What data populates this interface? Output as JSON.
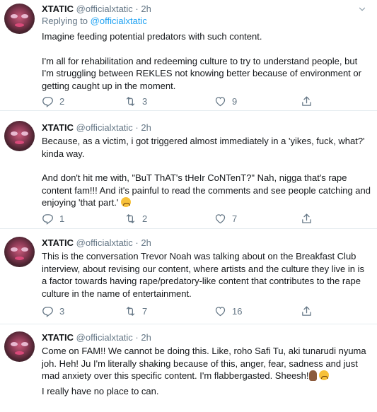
{
  "tweets": [
    {
      "name": "XTATIC",
      "handle": "@officialxtatic",
      "dot": "·",
      "time": "2h",
      "reply_prefix": "Replying to",
      "reply_to": "@officialxtatic",
      "paragraphs": [
        "Imagine feeding potential predators with such content.",
        "I'm all for rehabilitation and redeeming culture to try to understand people, but I'm struggling between REKLES not knowing better because of environment or getting caught up in the moment."
      ],
      "replies": "2",
      "retweets": "3",
      "likes": "9"
    },
    {
      "name": "XTATIC",
      "handle": "@officialxtatic",
      "dot": "·",
      "time": "2h",
      "paragraphs": [
        "Because, as a victim, i got triggered almost immediately in a 'yikes, fuck, what?' kinda way.",
        "And don't hit me with, \"BuT ThAT's tHeIr CoNTenT?\" Nah, nigga that's rape content fam!!! And it's painful to read the comments and see people catching and enjoying 'that part.'"
      ],
      "replies": "1",
      "retweets": "2",
      "likes": "7"
    },
    {
      "name": "XTATIC",
      "handle": "@officialxtatic",
      "dot": "·",
      "time": "2h",
      "paragraphs": [
        "This is the conversation Trevor Noah was talking about on the Breakfast Club interview, about revising our content, where artists and the culture they live in is a factor towards having rape/predatory-like content that contributes to the rape culture in the name of entertainment."
      ],
      "replies": "3",
      "retweets": "7",
      "likes": "16"
    },
    {
      "name": "XTATIC",
      "handle": "@officialxtatic",
      "dot": "·",
      "time": "2h",
      "paragraphs": [
        "Come on FAM!! We cannot be doing this. Like, roho Safi Tu, aki tunarudi nyuma joh. Heh! Ju I'm literally shaking because of this, anger, fear, sadness and just mad anxiety over this specific content. I'm flabbergasted. Sheesh!",
        "I really have no place to can."
      ]
    }
  ],
  "icons": {
    "reply": "reply-icon",
    "retweet": "retweet-icon",
    "like": "heart-icon",
    "share": "share-icon",
    "menu": "chevron-down-icon"
  },
  "colors": {
    "text": "#14171a",
    "muted": "#657786",
    "link": "#1da1f2",
    "divider": "#e6ecf0"
  }
}
